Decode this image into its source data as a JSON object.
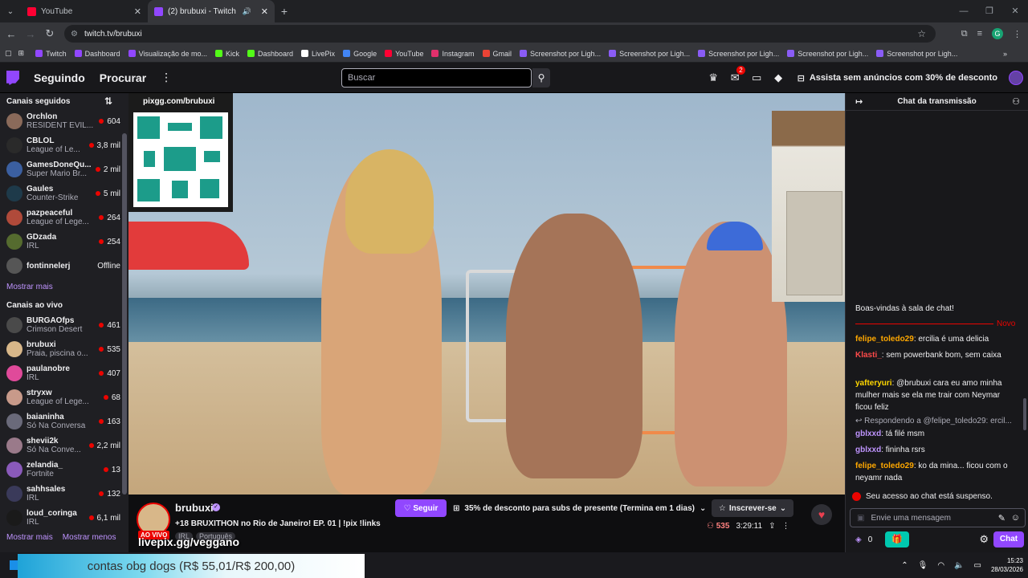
{
  "browser": {
    "tabs": [
      {
        "title": "YouTube",
        "color": "#ff0033",
        "active": false
      },
      {
        "title": "(2) brubuxi - Twitch",
        "color": "#9147ff",
        "active": true
      }
    ],
    "url": "twitch.tv/brubuxi",
    "bookmarks": [
      {
        "label": "Twitch",
        "color": "#9147ff"
      },
      {
        "label": "Dashboard",
        "color": "#9147ff"
      },
      {
        "label": "Visualização de mo...",
        "color": "#9147ff"
      },
      {
        "label": "Kick",
        "color": "#53fc18"
      },
      {
        "label": "Dashboard",
        "color": "#53fc18"
      },
      {
        "label": "LivePix",
        "color": "#ffffff"
      },
      {
        "label": "Google",
        "color": "#4285f4"
      },
      {
        "label": "YouTube",
        "color": "#ff0033"
      },
      {
        "label": "Instagram",
        "color": "#e1306c"
      },
      {
        "label": "Gmail",
        "color": "#ea4335"
      },
      {
        "label": "Screenshot por Ligh...",
        "color": "#8a5cf5"
      },
      {
        "label": "Screenshot por Ligh...",
        "color": "#8a5cf5"
      },
      {
        "label": "Screenshot por Ligh...",
        "color": "#8a5cf5"
      },
      {
        "label": "Screenshot por Ligh...",
        "color": "#8a5cf5"
      },
      {
        "label": "Screenshot por Ligh...",
        "color": "#8a5cf5"
      }
    ]
  },
  "topnav": {
    "following": "Seguindo",
    "browse": "Procurar",
    "search_placeholder": "Buscar",
    "notif_count": "2",
    "promo": "Assista sem anúncios com 30% de desconto"
  },
  "sidebar": {
    "followed_title": "Canais seguidos",
    "followed": [
      {
        "name": "Orchlon",
        "game": "RESIDENT EVIL...",
        "viewers": "604",
        "color": "#8a6a5a"
      },
      {
        "name": "CBLOL",
        "game": "League of Le...",
        "viewers": "3,8 mil",
        "color": "#2a2a2a"
      },
      {
        "name": "GamesDoneQu...",
        "game": "Super Mario Br...",
        "viewers": "2 mil",
        "color": "#3b5fa0"
      },
      {
        "name": "Gaules",
        "game": "Counter-Strike",
        "viewers": "5 mil",
        "color": "#1e3a4a"
      },
      {
        "name": "pazpeaceful",
        "game": "League of Lege...",
        "viewers": "264",
        "color": "#b04a3a"
      },
      {
        "name": "GDzada",
        "game": "IRL",
        "viewers": "254",
        "color": "#556b2f"
      },
      {
        "name": "fontinnelerj",
        "game": "",
        "viewers": "Offline",
        "color": "#555560"
      }
    ],
    "show_more": "Mostrar mais",
    "live_title": "Canais ao vivo",
    "live": [
      {
        "name": "BURGAOfps",
        "game": "Crimson Desert",
        "viewers": "461",
        "color": "#4a4a4a"
      },
      {
        "name": "brubuxi",
        "game": "Praia, piscina o...",
        "viewers": "535",
        "color": "#d8b789"
      },
      {
        "name": "paulanobre",
        "game": "IRL",
        "viewers": "407",
        "color": "#e04a9a"
      },
      {
        "name": "stryxw",
        "game": "League of Lege...",
        "viewers": "68",
        "color": "#c89a8a"
      },
      {
        "name": "baianinha",
        "game": "Só Na Conversa",
        "viewers": "163",
        "color": "#6a6a7a"
      },
      {
        "name": "shevii2k",
        "game": "Só Na Conve...",
        "viewers": "2,2 mil",
        "color": "#9a7a8a"
      },
      {
        "name": "zelandia_",
        "game": "Fortnite",
        "viewers": "13",
        "color": "#8a5aba"
      },
      {
        "name": "sahhsales",
        "game": "IRL",
        "viewers": "132",
        "color": "#3a3a5a"
      },
      {
        "name": "loud_coringa",
        "game": "IRL",
        "viewers": "6,1 mil",
        "color": "#1a1a1a"
      }
    ],
    "show_more2": "Mostrar mais",
    "show_less": "Mostrar menos"
  },
  "video": {
    "qr_label": "pixgg.com/brubuxi",
    "livepix_text": "livepix.gg/veggano"
  },
  "stream": {
    "channel": "brubuxi",
    "live_label": "AO VIVO",
    "title": "+18 BRUXITHON no Rio de Janeiro! EP. 01 | !pix !links",
    "tags": [
      "IRL",
      "Português"
    ],
    "follow": "Seguir",
    "promo": "35% de desconto para subs de presente (Termina em 1 dias)",
    "subscribe": "Inscrever-se",
    "viewers": "535",
    "uptime": "3:29:11"
  },
  "chat": {
    "header": "Chat da transmissão",
    "welcome": "Boas-vindas à sala de chat!",
    "new_label": "Novo",
    "messages": [
      {
        "user": "felipe_toledo29",
        "color": "#ffa800",
        "text": ": ercilia é uma delicia"
      },
      {
        "user": "Klasti_",
        "color": "#ff4a4a",
        "text": ": sem powerbank bom, sem caixa"
      },
      {
        "user": "yafteryuri",
        "color": "#ffd700",
        "text": ": @brubuxi cara eu amo minha mulher mais se ela me trair com Neymar ficou feliz"
      },
      {
        "user": "",
        "color": "#adadb8",
        "text": "Respondendo a @felipe_toledo29: ercil..."
      },
      {
        "user": "gblxxd",
        "color": "#bf94ff",
        "text": ": tá filé msm"
      },
      {
        "user": "gblxxd",
        "color": "#bf94ff",
        "text": ": fininha rsrs"
      },
      {
        "user": "felipe_toledo29",
        "color": "#ffa800",
        "text": ": ko da mina... ficou com o neyamr nada"
      }
    ],
    "suspended": "Seu acesso ao chat está suspenso.",
    "input_placeholder": "Envie uma mensagem",
    "points": "0",
    "chat_button": "Chat"
  },
  "taskbar": {
    "donation": "contas obg dogs (R$ 55,01/R$ 200,00)",
    "time": "15:23",
    "date": "28/03/2026"
  }
}
